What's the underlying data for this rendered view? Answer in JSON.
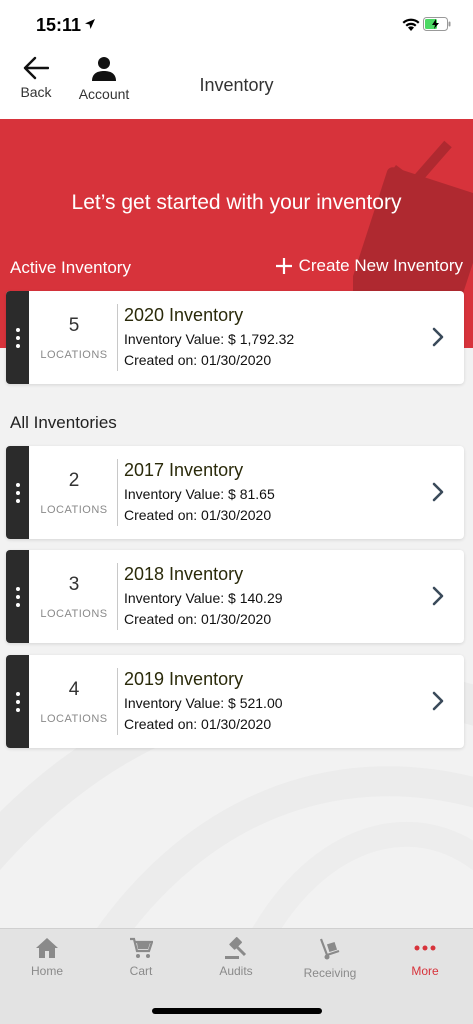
{
  "status": {
    "time": "15:11"
  },
  "nav": {
    "back_label": "Back",
    "account_label": "Account",
    "title": "Inventory"
  },
  "hero": {
    "heading": "Let’s get started with your inventory"
  },
  "active_section": {
    "title": "Active Inventory",
    "create_label": "Create New Inventory"
  },
  "active_inventory": {
    "count": "5",
    "count_label": "LOCATIONS",
    "name": "2020 Inventory",
    "value": "Inventory Value: $ 1,792.32",
    "created": "Created on: 01/30/2020"
  },
  "all_section": {
    "title": "All Inventories"
  },
  "inventories": [
    {
      "count": "2",
      "count_label": "LOCATIONS",
      "name": "2017 Inventory",
      "value": "Inventory Value: $ 81.65",
      "created": "Created on: 01/30/2020"
    },
    {
      "count": "3",
      "count_label": "LOCATIONS",
      "name": "2018 Inventory",
      "value": "Inventory Value: $ 140.29",
      "created": "Created on: 01/30/2020"
    },
    {
      "count": "4",
      "count_label": "LOCATIONS",
      "name": "2019 Inventory",
      "value": "Inventory Value: $ 521.00",
      "created": "Created on: 01/30/2020"
    }
  ],
  "tabs": [
    {
      "label": "Home",
      "icon": "home-icon"
    },
    {
      "label": "Cart",
      "icon": "cart-icon"
    },
    {
      "label": "Audits",
      "icon": "gavel-icon"
    },
    {
      "label": "Receiving",
      "icon": "hand-truck-icon"
    },
    {
      "label": "More",
      "icon": "more-dots-icon"
    }
  ],
  "colors": {
    "brand_red": "#d7333b",
    "handle_dark": "#2b2b2b",
    "tab_bar": "#e3e3e3"
  }
}
